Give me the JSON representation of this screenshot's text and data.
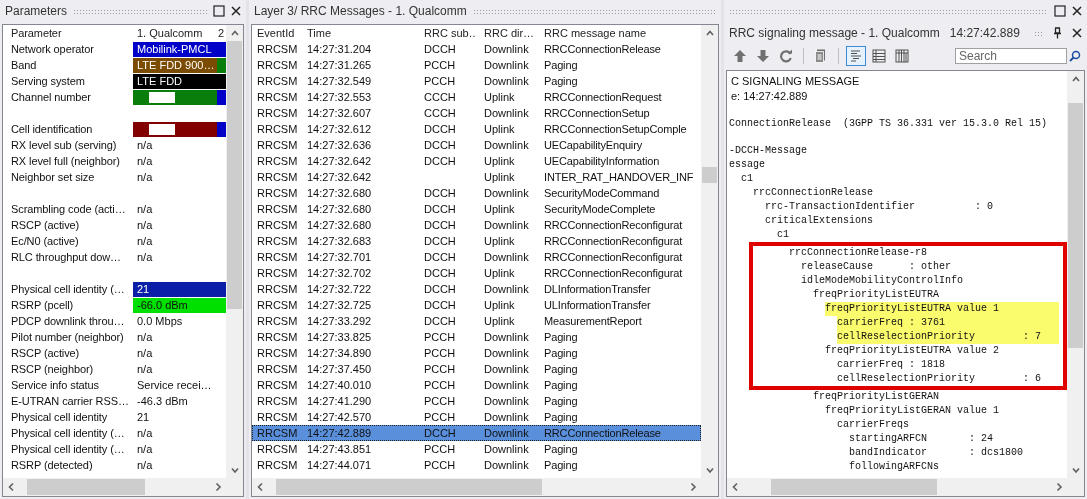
{
  "parameters": {
    "title": "Parameters",
    "columns": [
      "Parameter",
      "1. Qualcomm",
      "2"
    ],
    "rows": [
      {
        "kind": "param",
        "name": "Network operator",
        "value": "Mobilink-PMCL",
        "redacted": false,
        "color": "#0000c8",
        "column_3": {
          "color": "#0000c8"
        }
      },
      {
        "kind": "param",
        "name": "Band",
        "value": "LTE FDD 900…",
        "redacted": false,
        "color": "#7a4b00",
        "column_3": {
          "color": "#0a7e0a"
        }
      },
      {
        "kind": "param",
        "name": "Serving system",
        "value": "LTE FDD",
        "redacted": false,
        "color": "#000000",
        "column_3": {
          "color": "#000000"
        }
      },
      {
        "kind": "param",
        "name": "Channel number",
        "redacted": true,
        "color": "#0a7e0a",
        "column_3": {
          "color": "#0000c8"
        }
      },
      {
        "kind": "spacer"
      },
      {
        "kind": "param",
        "name": "Cell identification",
        "redacted": true,
        "color": "#820000",
        "column_3": {
          "color": "#0000c8"
        }
      },
      {
        "kind": "param",
        "name": "RX level sub (serving)",
        "value": "n/a",
        "redacted": false
      },
      {
        "kind": "param",
        "name": "RX level full (neighbor)",
        "value": "n/a",
        "redacted": false
      },
      {
        "kind": "param",
        "name": "Neighbor set size",
        "value": "n/a",
        "redacted": false
      },
      {
        "kind": "spacer"
      },
      {
        "kind": "param",
        "name": "Scrambling code (acti…",
        "value": "n/a",
        "redacted": false
      },
      {
        "kind": "param",
        "name": "RSCP (active)",
        "value": "n/a",
        "redacted": false
      },
      {
        "kind": "param",
        "name": "Ec/N0 (active)",
        "value": "n/a",
        "redacted": false
      },
      {
        "kind": "param",
        "name": "RLC throughput dow…",
        "value": "n/a",
        "redacted": false
      },
      {
        "kind": "spacer"
      },
      {
        "kind": "param",
        "name": "Physical cell identity (…",
        "value": "21",
        "redacted": false,
        "color": "#0a1ea8",
        "column_3": {
          "color": "#0a1ea8"
        }
      },
      {
        "kind": "param",
        "name": "RSRP (pcell)",
        "value": "-66.0 dBm",
        "redacted": false,
        "color": "#00e000",
        "column_3": {
          "color": "#00e000"
        }
      },
      {
        "kind": "param",
        "name": "PDCP downlink throu…",
        "value": "0.0 Mbps",
        "redacted": false
      },
      {
        "kind": "param",
        "name": "Pilot number (neighbor)",
        "value": "n/a",
        "redacted": false
      },
      {
        "kind": "param",
        "name": "RSCP (active)",
        "value": "n/a",
        "redacted": false
      },
      {
        "kind": "param",
        "name": "RSCP (neighbor)",
        "value": "n/a",
        "redacted": false
      },
      {
        "kind": "param",
        "name": "Service info status",
        "value": "Service recei…",
        "redacted": false
      },
      {
        "kind": "param",
        "name": "E-UTRAN carrier RSS…",
        "value": "-46.3 dBm",
        "redacted": false
      },
      {
        "kind": "param",
        "name": "Physical cell identity",
        "value": "21",
        "redacted": false
      },
      {
        "kind": "param",
        "name": "Physical cell identity (…",
        "value": "n/a",
        "redacted": false
      },
      {
        "kind": "param",
        "name": "Physical cell identity (…",
        "value": "n/a",
        "redacted": false
      },
      {
        "kind": "param",
        "name": "RSRP (detected)",
        "value": "n/a",
        "redacted": false
      }
    ]
  },
  "messages": {
    "title": "Layer 3/ RRC Messages - 1. Qualcomm",
    "columns": [
      "EventId",
      "Time",
      "RRC sub…",
      "RRC dir…",
      "RRC message name"
    ],
    "rows": [
      {
        "event_id": "RRCSM",
        "time": "14:27:31.204",
        "subchannel": "DCCH",
        "direction": "Downlink",
        "message": "RRCConnectionRelease",
        "selected": false
      },
      {
        "event_id": "RRCSM",
        "time": "14:27:31.265",
        "subchannel": "PCCH",
        "direction": "Downlink",
        "message": "Paging",
        "selected": false
      },
      {
        "event_id": "RRCSM",
        "time": "14:27:32.549",
        "subchannel": "PCCH",
        "direction": "Downlink",
        "message": "Paging",
        "selected": false
      },
      {
        "event_id": "RRCSM",
        "time": "14:27:32.553",
        "subchannel": "CCCH",
        "direction": "Uplink",
        "message": "RRCConnectionRequest",
        "selected": false
      },
      {
        "event_id": "RRCSM",
        "time": "14:27:32.607",
        "subchannel": "CCCH",
        "direction": "Downlink",
        "message": "RRCConnectionSetup",
        "selected": false
      },
      {
        "event_id": "RRCSM",
        "time": "14:27:32.612",
        "subchannel": "DCCH",
        "direction": "Uplink",
        "message": "RRCConnectionSetupComple",
        "selected": false
      },
      {
        "event_id": "RRCSM",
        "time": "14:27:32.636",
        "subchannel": "DCCH",
        "direction": "Downlink",
        "message": "UECapabilityEnquiry",
        "selected": false
      },
      {
        "event_id": "RRCSM",
        "time": "14:27:32.642",
        "subchannel": "DCCH",
        "direction": "Uplink",
        "message": "UECapabilityInformation",
        "selected": false
      },
      {
        "event_id": "RRCSM",
        "time": "14:27:32.642",
        "direction": "Uplink",
        "message": "INTER_RAT_HANDOVER_INF",
        "selected": false
      },
      {
        "event_id": "RRCSM",
        "time": "14:27:32.680",
        "subchannel": "DCCH",
        "direction": "Downlink",
        "message": "SecurityModeCommand",
        "selected": false
      },
      {
        "event_id": "RRCSM",
        "time": "14:27:32.680",
        "subchannel": "DCCH",
        "direction": "Uplink",
        "message": "SecurityModeComplete",
        "selected": false
      },
      {
        "event_id": "RRCSM",
        "time": "14:27:32.680",
        "subchannel": "DCCH",
        "direction": "Downlink",
        "message": "RRCConnectionReconfigurat",
        "selected": false
      },
      {
        "event_id": "RRCSM",
        "time": "14:27:32.683",
        "subchannel": "DCCH",
        "direction": "Uplink",
        "message": "RRCConnectionReconfigurat",
        "selected": false
      },
      {
        "event_id": "RRCSM",
        "time": "14:27:32.701",
        "subchannel": "DCCH",
        "direction": "Downlink",
        "message": "RRCConnectionReconfigurat",
        "selected": false
      },
      {
        "event_id": "RRCSM",
        "time": "14:27:32.702",
        "subchannel": "DCCH",
        "direction": "Uplink",
        "message": "RRCConnectionReconfigurat",
        "selected": false
      },
      {
        "event_id": "RRCSM",
        "time": "14:27:32.722",
        "subchannel": "DCCH",
        "direction": "Downlink",
        "message": "DLInformationTransfer",
        "selected": false
      },
      {
        "event_id": "RRCSM",
        "time": "14:27:32.725",
        "subchannel": "DCCH",
        "direction": "Uplink",
        "message": "ULInformationTransfer",
        "selected": false
      },
      {
        "event_id": "RRCSM",
        "time": "14:27:33.292",
        "subchannel": "DCCH",
        "direction": "Uplink",
        "message": "MeasurementReport",
        "selected": false
      },
      {
        "event_id": "RRCSM",
        "time": "14:27:33.825",
        "subchannel": "PCCH",
        "direction": "Downlink",
        "message": "Paging",
        "selected": false
      },
      {
        "event_id": "RRCSM",
        "time": "14:27:34.890",
        "subchannel": "PCCH",
        "direction": "Downlink",
        "message": "Paging",
        "selected": false
      },
      {
        "event_id": "RRCSM",
        "time": "14:27:37.450",
        "subchannel": "PCCH",
        "direction": "Downlink",
        "message": "Paging",
        "selected": false
      },
      {
        "event_id": "RRCSM",
        "time": "14:27:40.010",
        "subchannel": "PCCH",
        "direction": "Downlink",
        "message": "Paging",
        "selected": false
      },
      {
        "event_id": "RRCSM",
        "time": "14:27:41.290",
        "subchannel": "PCCH",
        "direction": "Downlink",
        "message": "Paging",
        "selected": false
      },
      {
        "event_id": "RRCSM",
        "time": "14:27:42.570",
        "subchannel": "PCCH",
        "direction": "Downlink",
        "message": "Paging",
        "selected": false
      },
      {
        "event_id": "RRCSM",
        "time": "14:27:42.889",
        "subchannel": "DCCH",
        "direction": "Downlink",
        "message": "RRCConnectionRelease",
        "selected": true
      },
      {
        "event_id": "RRCSM",
        "time": "14:27:43.851",
        "subchannel": "PCCH",
        "direction": "Downlink",
        "message": "Paging",
        "selected": false
      },
      {
        "event_id": "RRCSM",
        "time": "14:27:44.071",
        "subchannel": "PCCH",
        "direction": "Downlink",
        "message": "Paging",
        "selected": false
      }
    ]
  },
  "signaling": {
    "title": "RRC signaling message - 1. Qualcomm",
    "time": "14:27:42.889",
    "toolbar": [
      {
        "kind": "up",
        "selected": false
      },
      {
        "kind": "down",
        "selected": false
      },
      {
        "kind": "refresh",
        "selected": false
      },
      {
        "kind": "copy",
        "selected": false
      },
      {
        "kind": "tree-view",
        "selected": true
      },
      {
        "kind": "details-view",
        "selected": false
      },
      {
        "kind": "grid-view",
        "selected": false
      }
    ],
    "search": {
      "placeholder": "Search"
    },
    "lines": [
      {
        "kind": "heading",
        "text": "C SIGNALING MESSAGE"
      },
      {
        "kind": "heading",
        "text": "e: 14:27:42.889"
      },
      {
        "kind": "blank"
      },
      {
        "kind": "code",
        "text": "ConnectionRelease  (3GPP TS 36.331 ver 15.3.0 Rel 15)",
        "boxed": false,
        "highlighted": false
      },
      {
        "kind": "blank"
      },
      {
        "kind": "code",
        "text": "-DCCH-Message",
        "boxed": false,
        "highlighted": false
      },
      {
        "kind": "code",
        "text": "essage",
        "boxed": false,
        "highlighted": false,
        "children": [
          {
            "kind": "code",
            "text": "c1",
            "boxed": false,
            "highlighted": false,
            "children": [
              {
                "kind": "code",
                "text": "rrcConnectionRelease",
                "boxed": false,
                "highlighted": false,
                "children": [
                  {
                    "kind": "code",
                    "text": "rrc-TransactionIdentifier          : 0",
                    "boxed": false,
                    "highlighted": false
                  },
                  {
                    "kind": "code",
                    "text": "criticalExtensions",
                    "boxed": false,
                    "highlighted": false,
                    "children": [
                      {
                        "kind": "code",
                        "text": "c1",
                        "boxed": false,
                        "highlighted": false,
                        "children": [
                          {
                            "kind": "code",
                            "text": "rrcConnectionRelease-r8",
                            "boxed": true,
                            "highlighted": false,
                            "children": [
                              {
                                "kind": "code",
                                "text": "releaseCause      : other",
                                "boxed": true,
                                "highlighted": false
                              },
                              {
                                "kind": "code",
                                "text": "idleModeMobilityControlInfo",
                                "boxed": true,
                                "highlighted": false,
                                "children": [
                                  {
                                    "kind": "code",
                                    "text": "freqPriorityListEUTRA",
                                    "boxed": true,
                                    "highlighted": false,
                                    "children": [
                                      {
                                        "kind": "code",
                                        "text": "freqPriorityListEUTRA value 1",
                                        "boxed": true,
                                        "highlighted": true,
                                        "children": [
                                          {
                                            "kind": "code",
                                            "text": "carrierFreq : 3761",
                                            "boxed": true,
                                            "highlighted": true
                                          },
                                          {
                                            "kind": "code",
                                            "text": "cellReselectionPriority        : 7",
                                            "boxed": true,
                                            "highlighted": true
                                          }
                                        ]
                                      },
                                      {
                                        "kind": "code",
                                        "text": "freqPriorityListEUTRA value 2",
                                        "boxed": true,
                                        "highlighted": false,
                                        "children": [
                                          {
                                            "kind": "code",
                                            "text": "carrierFreq : 1818",
                                            "boxed": true,
                                            "highlighted": false
                                          },
                                          {
                                            "kind": "code",
                                            "text": "cellReselectionPriority        : 6",
                                            "boxed": true,
                                            "highlighted": false
                                          }
                                        ]
                                      }
                                    ]
                                  },
                                  {
                                    "kind": "code",
                                    "text": "freqPriorityListGERAN",
                                    "boxed": false,
                                    "highlighted": false,
                                    "children": [
                                      {
                                        "kind": "code",
                                        "text": "freqPriorityListGERAN value 1",
                                        "boxed": false,
                                        "highlighted": false,
                                        "children": [
                                          {
                                            "kind": "code",
                                            "text": "carrierFreqs",
                                            "boxed": false,
                                            "highlighted": false,
                                            "children": [
                                              {
                                                "kind": "code",
                                                "text": "startingARFCN       : 24",
                                                "boxed": false,
                                                "highlighted": false
                                              },
                                              {
                                                "kind": "code",
                                                "text": "bandIndicator       : dcs1800",
                                                "boxed": false,
                                                "highlighted": false
                                              },
                                              {
                                                "kind": "code",
                                                "text": "followingARFCNs",
                                                "boxed": false,
                                                "highlighted": false
                                              }
                                            ]
                                          }
                                        ]
                                      }
                                    ]
                                  }
                                ]
                              }
                            ]
                          }
                        ]
                      }
                    ]
                  }
                ]
              }
            ]
          }
        ]
      }
    ]
  }
}
